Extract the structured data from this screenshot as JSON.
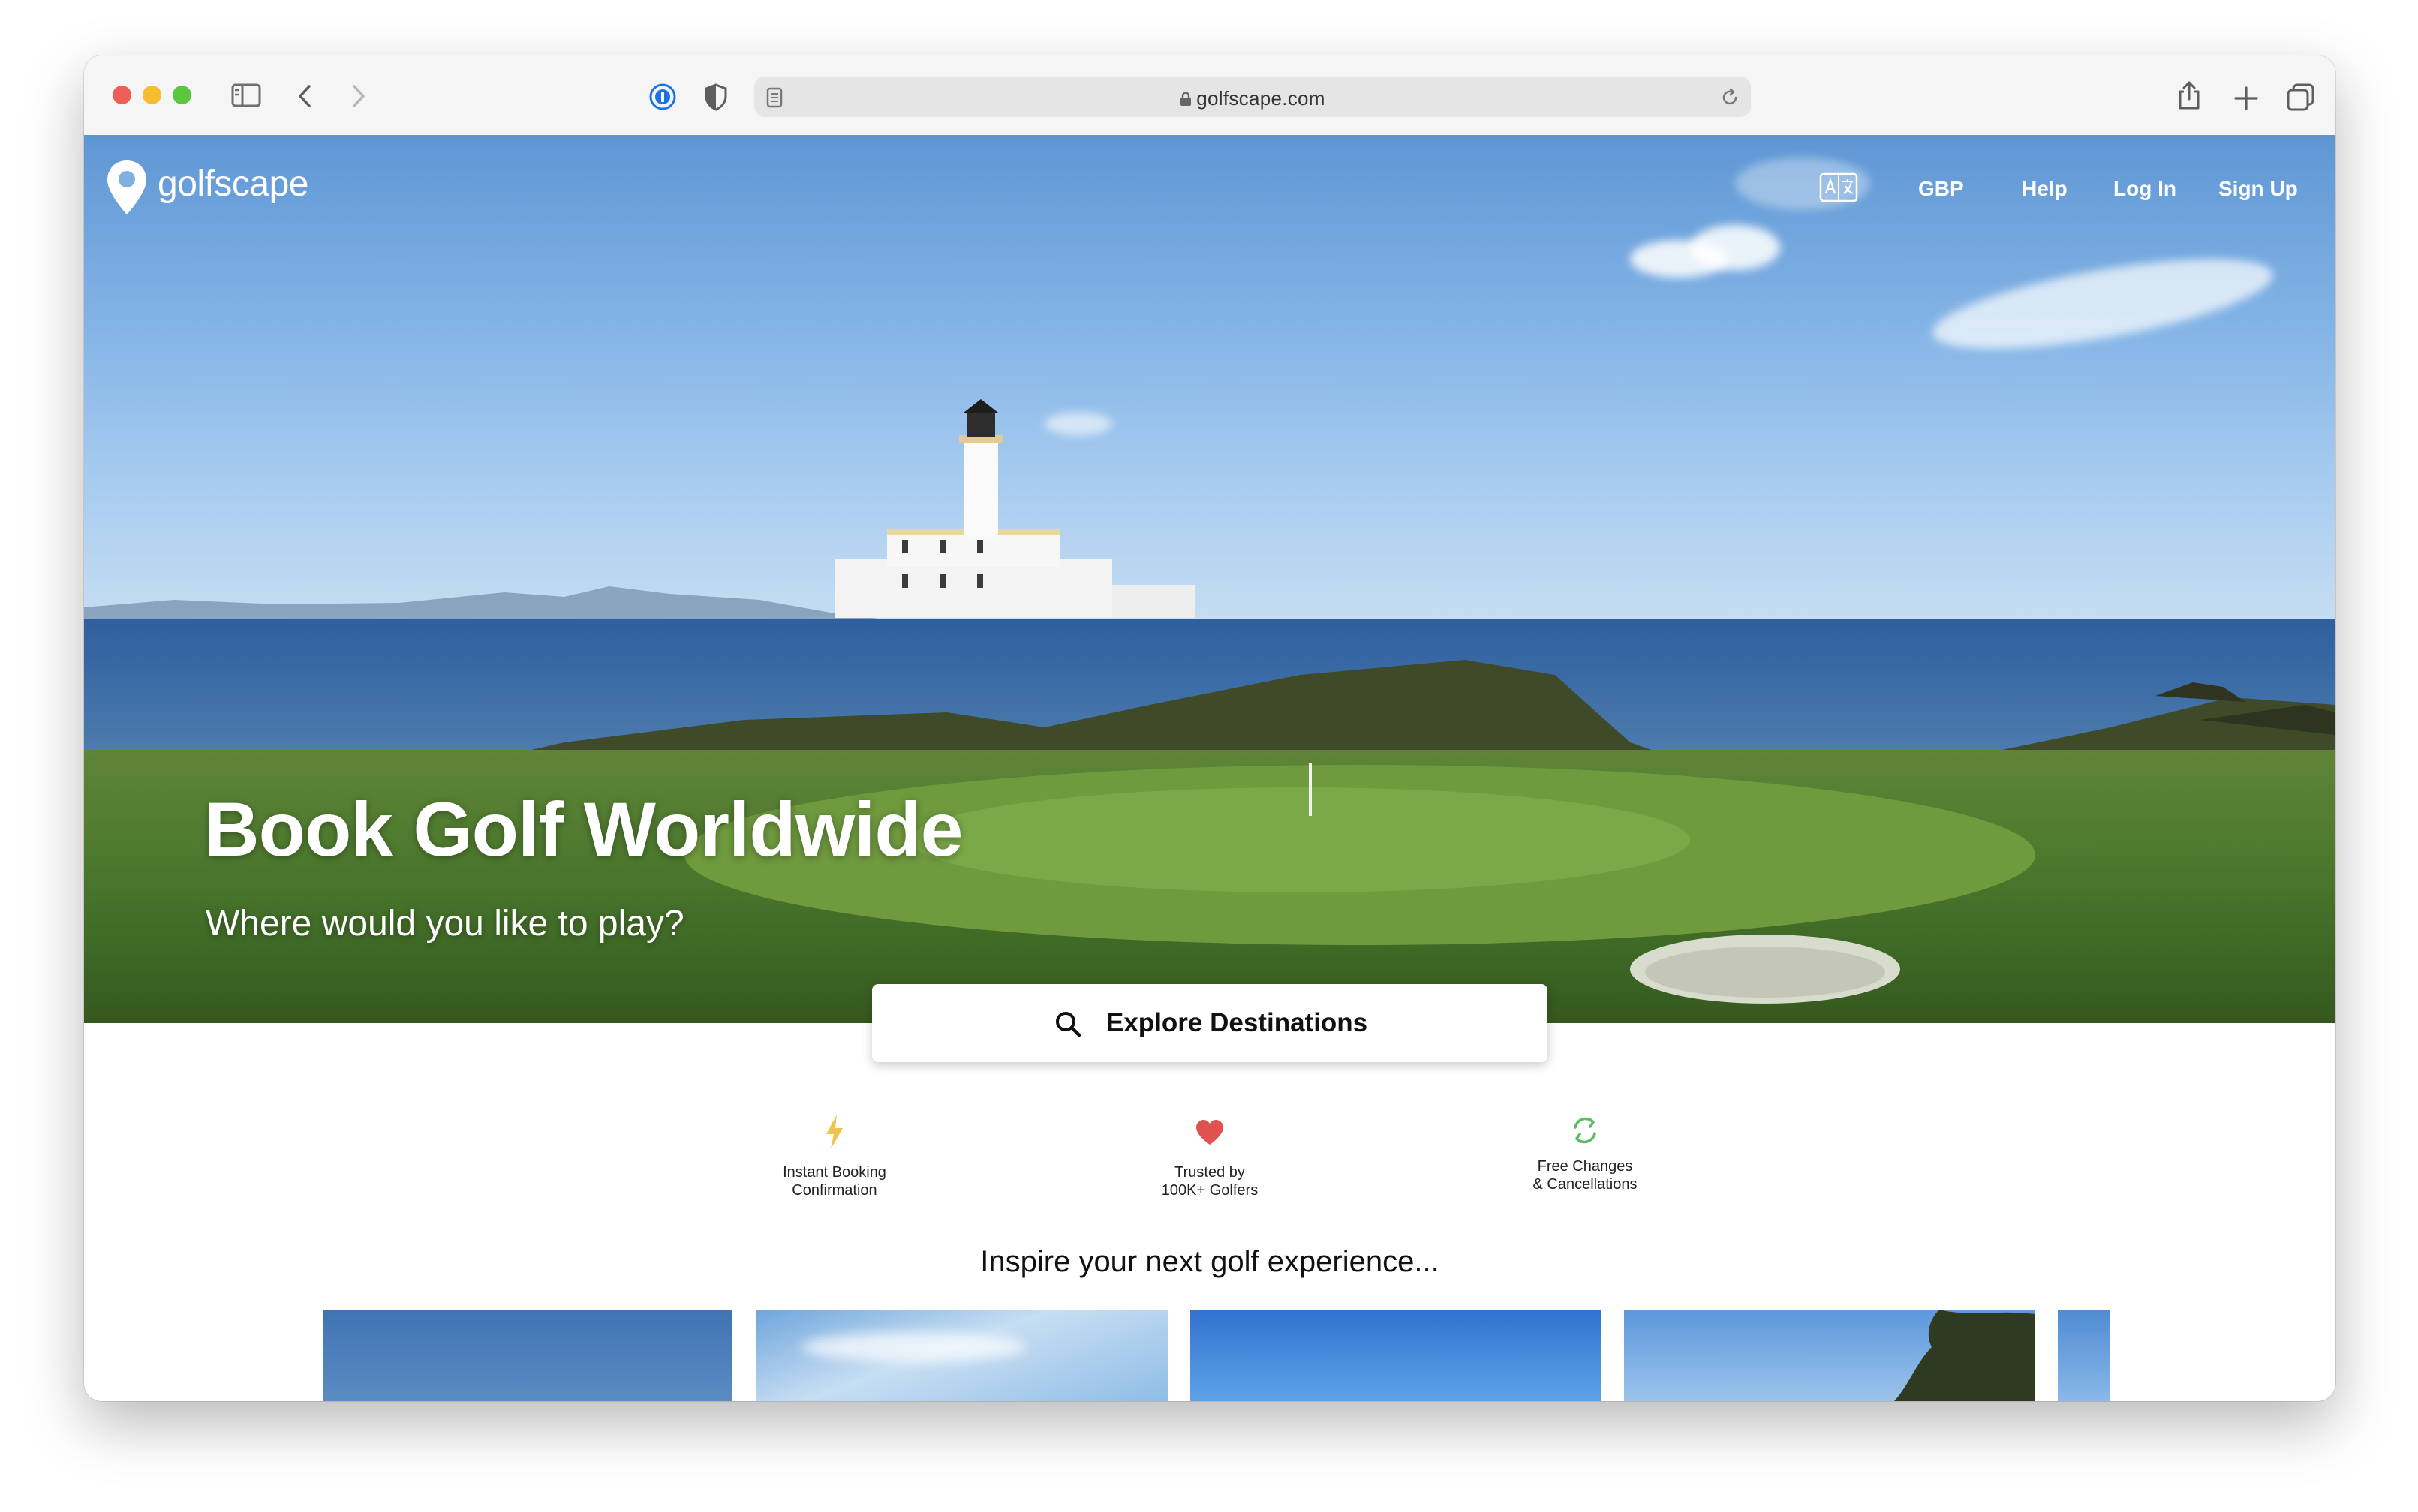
{
  "browser": {
    "url": "golfscape.com",
    "traffic_lights": {
      "close": "#ee5f57",
      "minimize": "#f5bd2f",
      "maximize": "#5cc63f"
    }
  },
  "site": {
    "logo_text": "golfscape",
    "nav": {
      "currency": "GBP",
      "help": "Help",
      "login": "Log In",
      "signup": "Sign Up"
    }
  },
  "hero": {
    "title": "Book Golf Worldwide",
    "subtitle": "Where would you like to play?"
  },
  "search": {
    "label": "Explore Destinations"
  },
  "features": [
    {
      "icon": "lightning-icon",
      "color": "#f2c14e",
      "text": "Instant Booking\nConfirmation"
    },
    {
      "icon": "heart-icon",
      "color": "#e0524f",
      "text": "Trusted by\n100K+ Golfers"
    },
    {
      "icon": "refresh-icon",
      "color": "#5dbb63",
      "text": "Free Changes\n& Cancellations"
    }
  ],
  "inspire": {
    "heading": "Inspire your next golf experience..."
  }
}
